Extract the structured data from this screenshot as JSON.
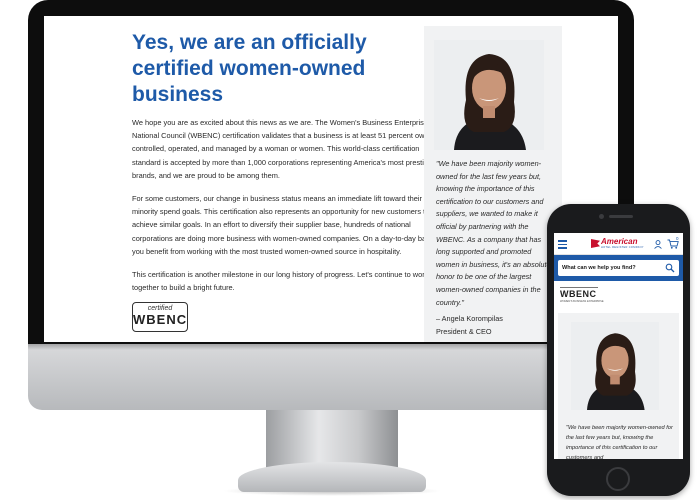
{
  "desktop": {
    "headline": "Yes, we are an officially certified women-owned business",
    "paragraphs": [
      "We hope you are as excited about this news as we are. The Women's Business Enterprise National Council (WBENC) certification validates that a business is at least 51 percent owned, controlled, operated, and managed by a woman or women. This world-class certification standard is accepted by more than 1,000 corporations representing America's most prestigious brands, and we are proud to be among them.",
      "For some customers, our change in business status means an immediate lift toward their minority spend goals. This certification also represents an opportunity for new customers to achieve similar goals. In an effort to diversify their supplier base, hundreds of national corporations are doing more business with women-owned companies. On a day-to-day basis, you benefit from working with the most trusted women-owned source in hospitality.",
      "This certification is another milestone in our long history of progress. Let's continue to work together to build a bright future."
    ],
    "badge": {
      "top": "certified",
      "main": "WBENC"
    },
    "quote": "\"We have been majority women-owned for the last few years but, knowing the importance of this certification to our customers and suppliers, we wanted to make it official by partnering with the WBENC. As a company that has long supported and promoted women in business, it's an absolute honor to be one of the largest women-owned companies in the country.\"",
    "attribution_name": "– Angela Korompilas",
    "attribution_title": "President & CEO"
  },
  "mobile": {
    "logo_brand": "American",
    "logo_sub": "HOTEL REGISTER COMPANY",
    "cart_count": "0",
    "search_placeholder": "What can we help you find?",
    "badge_main": "WBENC",
    "badge_sub": "WOMEN'S BUSINESS ENTERPRISE",
    "quote": "\"We have been majority women-owned for the last few years but, knowing the importance of this certification to our customers and"
  },
  "colors": {
    "brand_blue": "#1e5aa8",
    "brand_red": "#c8102e",
    "panel_gray": "#f1f2f3"
  },
  "icons": [
    "hamburger-menu-icon",
    "user-icon",
    "cart-icon",
    "search-icon"
  ]
}
